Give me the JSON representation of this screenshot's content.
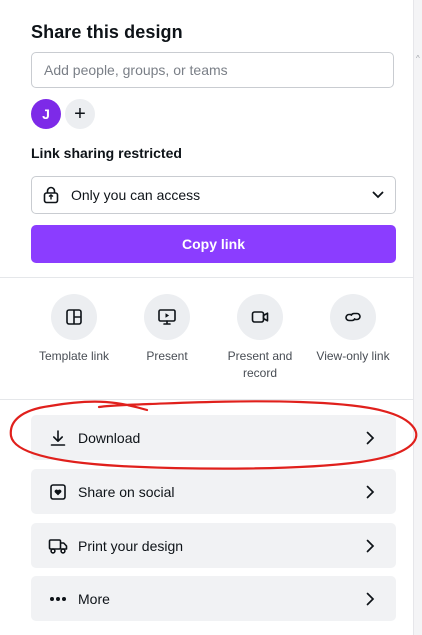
{
  "share": {
    "title": "Share this design",
    "search_placeholder": "Add people, groups, or teams",
    "avatar_initial": "J",
    "add_symbol": "+",
    "link_label": "Link sharing restricted",
    "access_value": "Only you can access",
    "copy_label": "Copy link"
  },
  "quick_actions": [
    {
      "label": "Template link",
      "icon": "template-icon"
    },
    {
      "label": "Present",
      "icon": "present-icon"
    },
    {
      "label": "Present and record",
      "icon": "record-camera-icon"
    },
    {
      "label": "View-only link",
      "icon": "link-icon"
    }
  ],
  "rows": [
    {
      "label": "Download",
      "icon": "download-icon"
    },
    {
      "label": "Share on social",
      "icon": "heart-icon"
    },
    {
      "label": "Print your design",
      "icon": "truck-icon"
    },
    {
      "label": "More",
      "icon": "more-icon"
    }
  ],
  "colors": {
    "accent": "#8b3dff",
    "avatar": "#7d2ae8",
    "annotation": "#e0201c"
  }
}
